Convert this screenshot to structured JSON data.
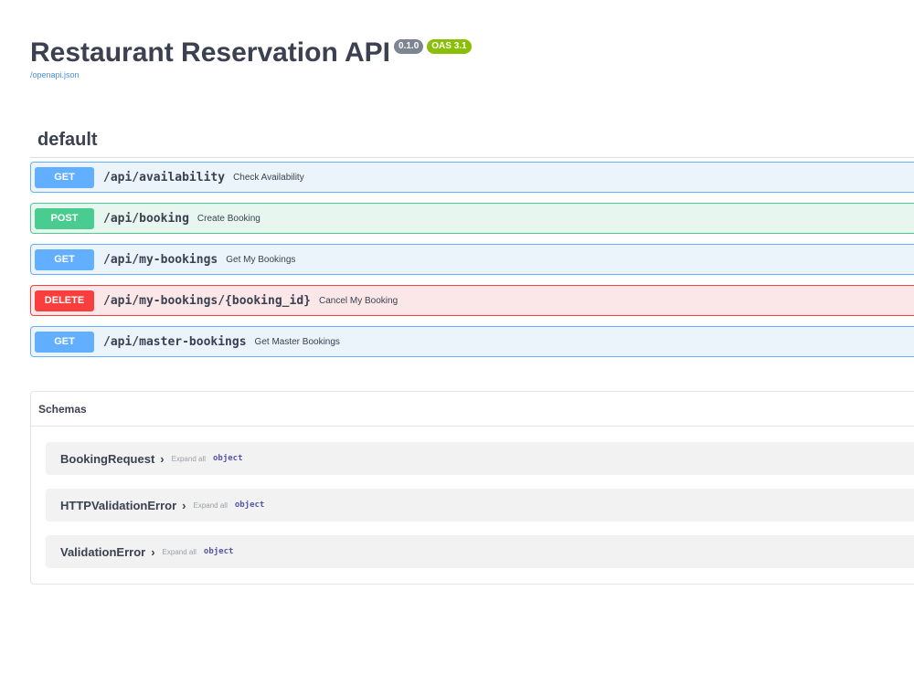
{
  "info": {
    "title": "Restaurant Reservation API",
    "version": "0.1.0",
    "oas": "OAS 3.1",
    "spec_link": "/openapi.json"
  },
  "tag": {
    "name": "default"
  },
  "operations": [
    {
      "method": "GET",
      "path": "/api/availability",
      "summary": "Check Availability"
    },
    {
      "method": "POST",
      "path": "/api/booking",
      "summary": "Create Booking"
    },
    {
      "method": "GET",
      "path": "/api/my-bookings",
      "summary": "Get My Bookings"
    },
    {
      "method": "DELETE",
      "path": "/api/my-bookings/{booking_id}",
      "summary": "Cancel My Booking"
    },
    {
      "method": "GET",
      "path": "/api/master-bookings",
      "summary": "Get Master Bookings"
    }
  ],
  "schemas": {
    "title": "Schemas",
    "models": [
      {
        "name": "BookingRequest",
        "expand_label": "Expand all",
        "type": "object"
      },
      {
        "name": "HTTPValidationError",
        "expand_label": "Expand all",
        "type": "object"
      },
      {
        "name": "ValidationError",
        "expand_label": "Expand all",
        "type": "object"
      }
    ]
  },
  "colors": {
    "get": "#61affe",
    "post": "#49cc90",
    "delete": "#f93e3e",
    "version_badge": "#7d8492",
    "oas_badge": "#89bf04"
  }
}
